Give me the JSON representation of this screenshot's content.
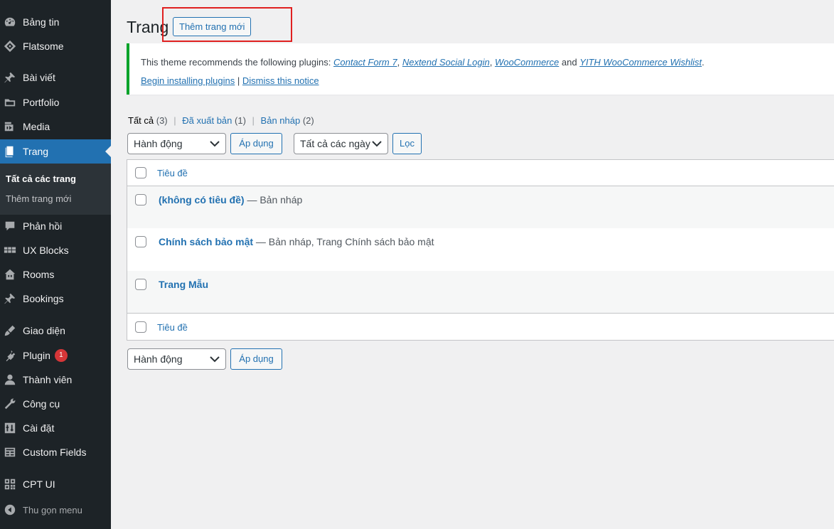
{
  "sidebar": {
    "items": [
      {
        "label": "Bảng tin",
        "icon": "dashboard-icon"
      },
      {
        "label": "Flatsome",
        "icon": "flatsome-icon"
      },
      {
        "label": "Bài viết",
        "icon": "pin-icon"
      },
      {
        "label": "Portfolio",
        "icon": "folder-icon"
      },
      {
        "label": "Media",
        "icon": "media-icon"
      },
      {
        "label": "Trang",
        "icon": "page-icon"
      },
      {
        "label": "Phản hồi",
        "icon": "comment-icon"
      },
      {
        "label": "UX Blocks",
        "icon": "blocks-icon"
      },
      {
        "label": "Rooms",
        "icon": "building-icon"
      },
      {
        "label": "Bookings",
        "icon": "pin-icon"
      },
      {
        "label": "Giao diện",
        "icon": "brush-icon"
      },
      {
        "label": "Plugin",
        "icon": "plugin-icon",
        "badge": "1"
      },
      {
        "label": "Thành viên",
        "icon": "user-icon"
      },
      {
        "label": "Công cụ",
        "icon": "wrench-icon"
      },
      {
        "label": "Cài đặt",
        "icon": "settings-icon"
      },
      {
        "label": "Custom Fields",
        "icon": "table-icon"
      },
      {
        "label": "CPT UI",
        "icon": "grid-icon"
      }
    ],
    "submenu": [
      "Tất cả các trang",
      "Thêm trang mới"
    ],
    "collapse": "Thu gọn menu"
  },
  "header": {
    "title": "Trang",
    "add_new": "Thêm trang mới"
  },
  "notice": {
    "text": "This theme recommends the following plugins:",
    "plugins": [
      "Contact Form 7",
      "Nextend Social Login",
      "WooCommerce",
      "YITH WooCommerce Wishlist"
    ],
    "sep": ",",
    "and": "and",
    "end": ".",
    "begin": "Begin installing plugins",
    "pipe": "|",
    "dismiss": "Dismiss this notice"
  },
  "filters": {
    "all": "Tất cả",
    "all_count": "(3)",
    "published": "Đã xuất bản",
    "published_count": "(1)",
    "draft": "Bản nháp",
    "draft_count": "(2)",
    "sep": "|"
  },
  "bulk": {
    "action": "Hành động",
    "apply": "Áp dụng",
    "dates": "Tất cả các ngày",
    "filter": "Lọc"
  },
  "table": {
    "header": "Tiêu đề",
    "rows": [
      {
        "title": "(không có tiêu đề)",
        "state": "— Bản nháp"
      },
      {
        "title": "Chính sách bảo mật",
        "state": "— Bản nháp, Trang Chính sách bảo mật"
      },
      {
        "title": "Trang Mẫu",
        "state": ""
      }
    ]
  },
  "colors": {
    "sidebar_bg": "#1d2327",
    "active": "#2271b1",
    "link": "#2271b1",
    "notice_border": "#00a32a",
    "highlight": "#e02020",
    "badge": "#d63638"
  }
}
